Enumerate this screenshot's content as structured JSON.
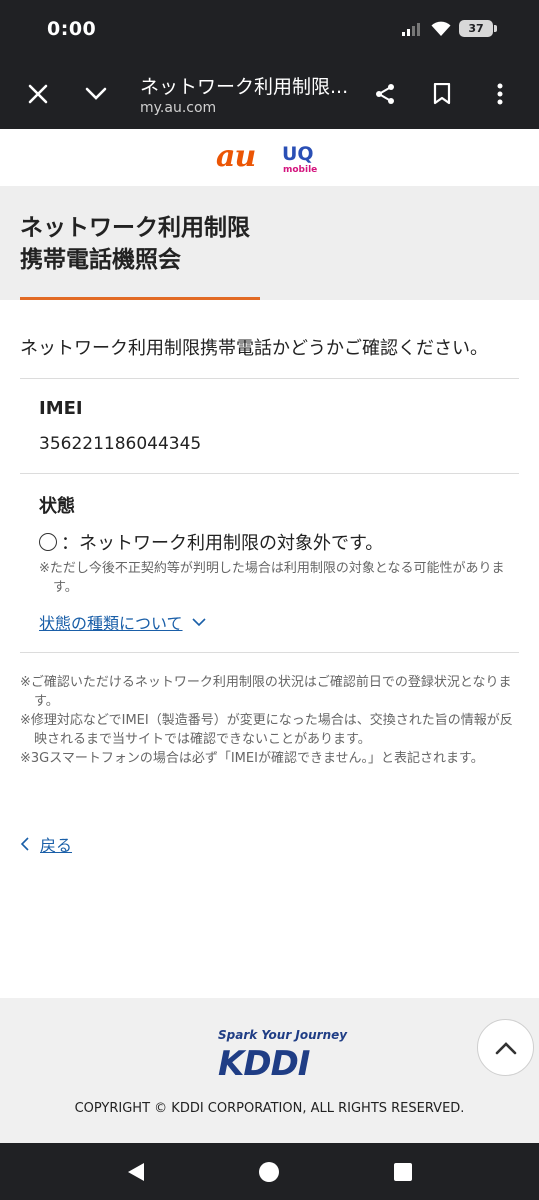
{
  "status_bar": {
    "time": "0:00",
    "battery": "37"
  },
  "browser": {
    "title": "ネットワーク利用制限...",
    "url": "my.au.com"
  },
  "brand": {
    "au": "au",
    "uq_top": "UQ",
    "uq_bottom": "mobile",
    "accent": "#eb5505"
  },
  "page": {
    "title": "ネットワーク利用制限\n携帯電話機照会",
    "intro": "ネットワーク利用制限携帯電話かどうかご確認ください。",
    "imei_label": "IMEI",
    "imei_value": "356221186044345",
    "status_label": "状態",
    "status_value": "：ネットワーク利用制限の対象外です。",
    "status_note": "※ただし今後不正契約等が判明した場合は利用制限の対象となる可能性があります。",
    "status_link": "状態の種類について",
    "notes": [
      "※ご確認いただけるネットワーク利用制限の状況はご確認前日での登録状況となります。",
      "※修理対応などでIMEI（製造番号）が変更になった場合は、交換された旨の情報が反映されるまで当サイトでは確認できないことがあります。",
      "※3Gスマートフォンの場合は必ず「IMEIが確認できません。」と表記されます。"
    ],
    "back_link": "戻る"
  },
  "footer": {
    "tagline": "Spark Your Journey",
    "logo": "KDDI",
    "copyright": "COPYRIGHT © KDDI CORPORATION, ALL RIGHTS RESERVED."
  }
}
